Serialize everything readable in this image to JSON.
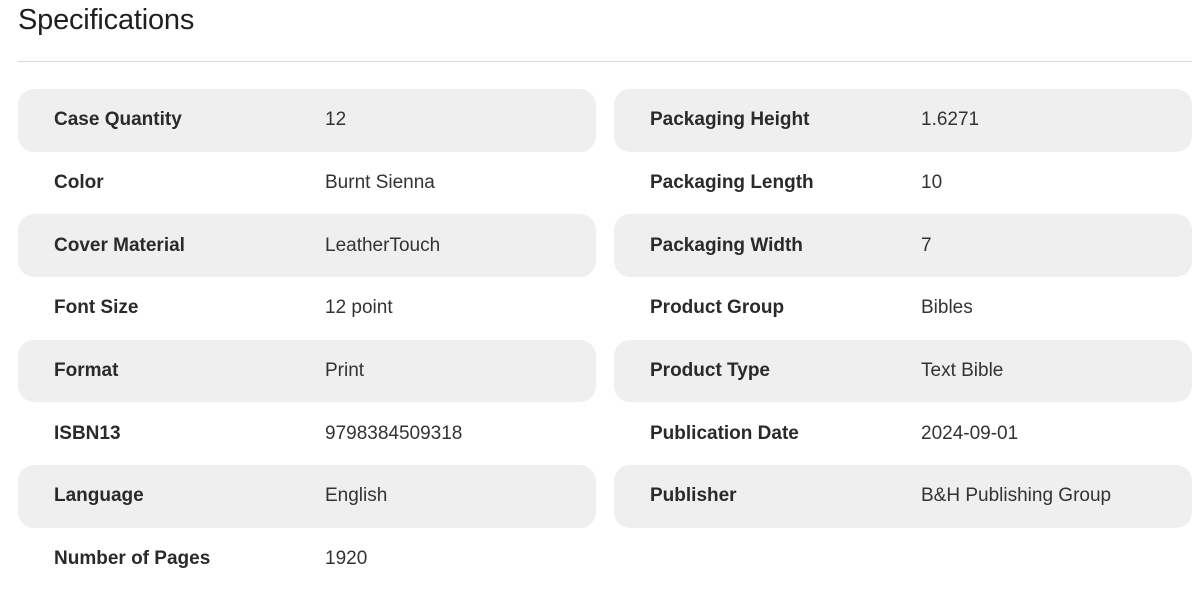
{
  "title": "Specifications",
  "left_specs": [
    {
      "label": "Case Quantity",
      "value": "12"
    },
    {
      "label": "Color",
      "value": "Burnt Sienna"
    },
    {
      "label": "Cover Material",
      "value": "LeatherTouch"
    },
    {
      "label": "Font Size",
      "value": "12 point"
    },
    {
      "label": "Format",
      "value": "Print"
    },
    {
      "label": "ISBN13",
      "value": "9798384509318"
    },
    {
      "label": "Language",
      "value": "English"
    },
    {
      "label": "Number of Pages",
      "value": "1920"
    }
  ],
  "right_specs": [
    {
      "label": "Packaging Height",
      "value": "1.6271"
    },
    {
      "label": "Packaging Length",
      "value": "10"
    },
    {
      "label": "Packaging Width",
      "value": "7"
    },
    {
      "label": "Product Group",
      "value": "Bibles"
    },
    {
      "label": "Product Type",
      "value": "Text Bible"
    },
    {
      "label": "Publication Date",
      "value": "2024-09-01"
    },
    {
      "label": "Publisher",
      "value": "B&H Publishing Group"
    }
  ],
  "colors": {
    "row_shade": "#efefef",
    "divider": "#d8d8d8",
    "text": "#222222"
  }
}
